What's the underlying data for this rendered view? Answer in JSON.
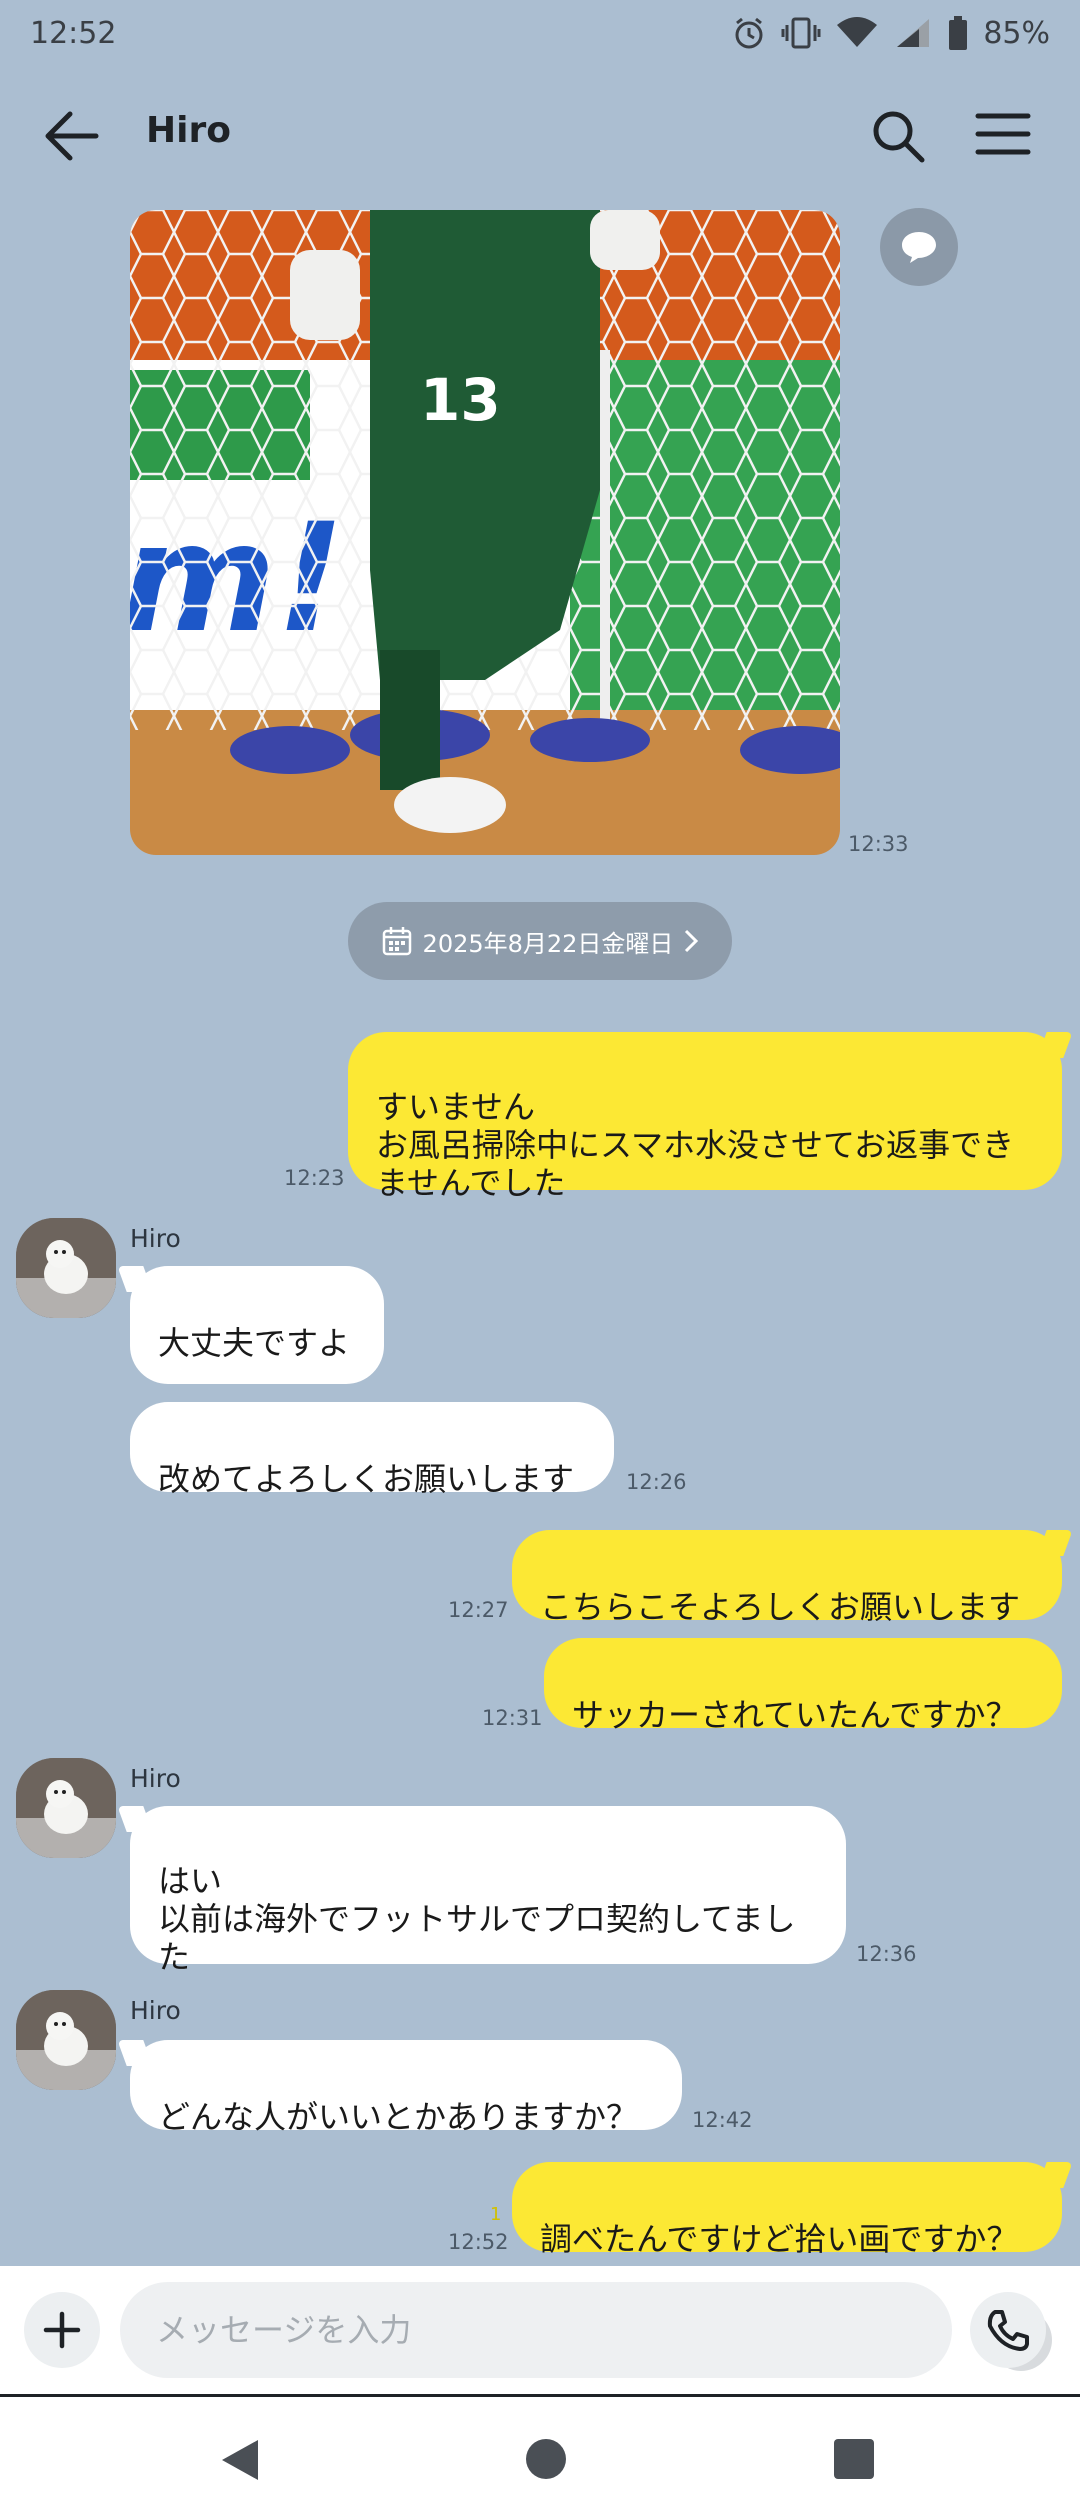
{
  "status": {
    "time": "12:52",
    "battery": "85%",
    "icons": [
      "alarm-icon",
      "vibrate-icon",
      "wifi-icon",
      "signal-icon",
      "battery-icon"
    ]
  },
  "header": {
    "title": "Hiro",
    "icons": [
      "back-arrow-icon",
      "search-icon",
      "menu-icon"
    ]
  },
  "photo": {
    "time": "12:33",
    "jersey_number": "13"
  },
  "date_chip": {
    "label": "2025年8月22日金曜日",
    "icon": "calendar-icon"
  },
  "messages": [
    {
      "from": "me",
      "text": "すいません\nお風呂掃除中にスマホ水没させてお返事できませんでした",
      "time": "12:23"
    },
    {
      "from": "them",
      "sender": "Hiro",
      "text": "大丈夫ですよ",
      "time": ""
    },
    {
      "from": "them",
      "text": "改めてよろしくお願いします",
      "time": "12:26"
    },
    {
      "from": "me",
      "text": "こちらこそよろしくお願いします",
      "time": "12:27"
    },
    {
      "from": "me",
      "text": "サッカーされていたんですか？",
      "time": "12:31"
    },
    {
      "from": "them",
      "sender": "Hiro",
      "text": "はい\n以前は海外でフットサルでプロ契約してました",
      "time": "12:36"
    },
    {
      "from": "them",
      "sender": "Hiro",
      "text": "どんな人がいいとかありますか？",
      "time": "12:42"
    },
    {
      "from": "me",
      "text": "調べたんですけど拾い画ですか？",
      "time": "12:52",
      "read_count": "1"
    }
  ],
  "input": {
    "placeholder": "メッセージを入力",
    "icons": [
      "plus-icon",
      "emoji-icon",
      "phone-icon"
    ]
  },
  "navigation": {
    "icons": [
      "nav-back-icon",
      "nav-home-icon",
      "nav-recents-icon"
    ]
  },
  "colors": {
    "background": "#abbed1",
    "my_bubble": "#fce834",
    "their_bubble": "#ffffff"
  }
}
